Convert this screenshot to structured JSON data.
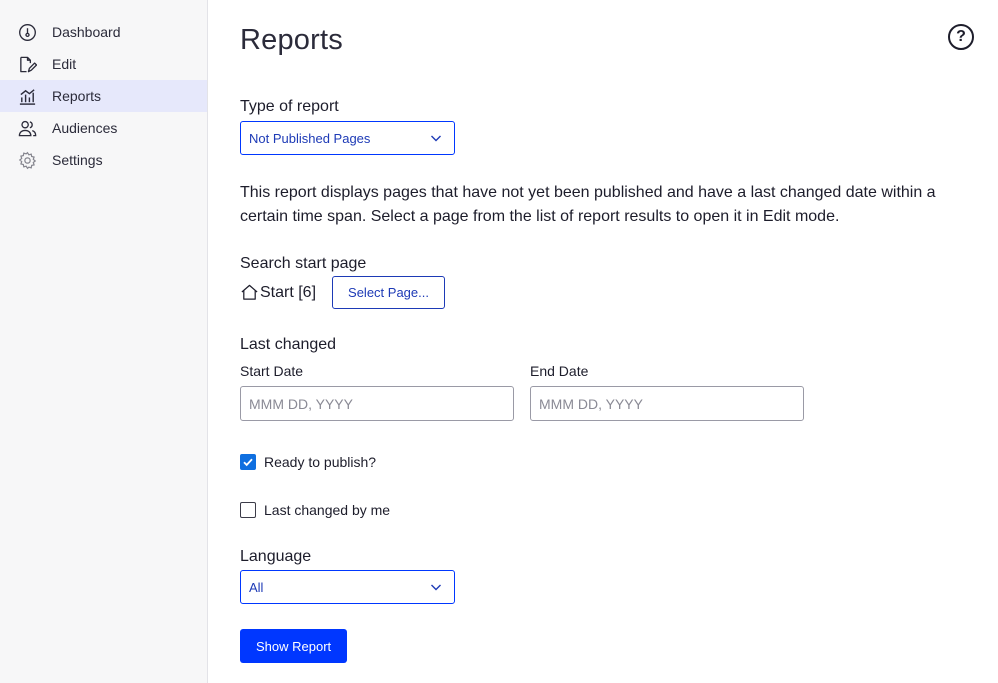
{
  "sidebar": {
    "items": [
      {
        "label": "Dashboard",
        "icon": "dashboard-gauge-icon"
      },
      {
        "label": "Edit",
        "icon": "edit-pencil-icon"
      },
      {
        "label": "Reports",
        "icon": "reports-chart-icon",
        "active": true
      },
      {
        "label": "Audiences",
        "icon": "audiences-users-icon"
      },
      {
        "label": "Settings",
        "icon": "gear-icon"
      }
    ]
  },
  "main": {
    "title": "Reports",
    "help_icon": "question-circle-icon",
    "type_of_report": {
      "label": "Type of report",
      "selected": "Not Published Pages"
    },
    "description": "This report displays pages that have not yet been published and have a last changed date within a certain time span. Select a page from the list of report results to open it in Edit mode.",
    "search_start_page": {
      "label": "Search start page",
      "value": "Start [6]",
      "button_label": "Select Page..."
    },
    "last_changed": {
      "label": "Last changed",
      "start_date_label": "Start Date",
      "start_date_placeholder": "MMM DD, YYYY",
      "end_date_label": "End Date",
      "end_date_placeholder": "MMM DD, YYYY"
    },
    "ready_to_publish": {
      "label": "Ready to publish?",
      "checked": true
    },
    "last_changed_by_me": {
      "label": "Last changed by me",
      "checked": false
    },
    "language": {
      "label": "Language",
      "selected": "All"
    },
    "show_report_label": "Show Report"
  },
  "colors": {
    "accent": "#0037ff",
    "link": "#1d3ab6",
    "sidebar_bg": "#f7f7f8",
    "active_item_bg": "#e6e8fb",
    "checkbox_checked": "#0f6fe0"
  }
}
